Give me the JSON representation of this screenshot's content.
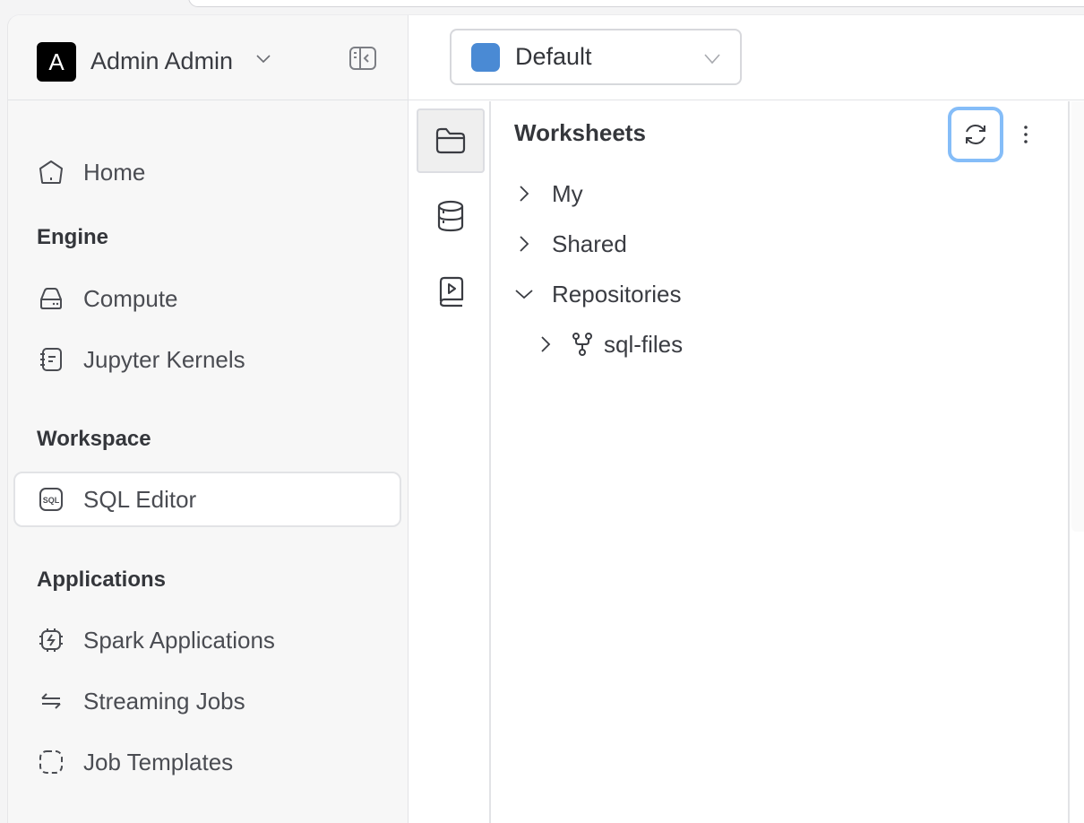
{
  "user": {
    "avatar_letter": "A",
    "name": "Admin Admin"
  },
  "sidebar": {
    "home_label": "Home",
    "sections": [
      {
        "title": "Engine",
        "items": [
          {
            "label": "Compute",
            "icon": "server-icon"
          },
          {
            "label": "Jupyter Kernels",
            "icon": "notebook-icon"
          }
        ]
      },
      {
        "title": "Workspace",
        "items": [
          {
            "label": "SQL Editor",
            "icon": "sql-icon",
            "active": true
          }
        ]
      },
      {
        "title": "Applications",
        "items": [
          {
            "label": "Spark Applications",
            "icon": "spark-chip-icon"
          },
          {
            "label": "Streaming Jobs",
            "icon": "arrows-exchange-icon"
          },
          {
            "label": "Job Templates",
            "icon": "dashed-square-icon"
          }
        ]
      }
    ]
  },
  "header": {
    "environment": {
      "label": "Default",
      "color": "#4a8ad4"
    }
  },
  "rail": {
    "items": [
      {
        "name": "worksheets",
        "icon": "folder-icon",
        "active": true
      },
      {
        "name": "database",
        "icon": "database-icon",
        "active": false
      },
      {
        "name": "tutorials",
        "icon": "book-play-icon",
        "active": false
      }
    ]
  },
  "panel": {
    "title": "Worksheets",
    "tree": [
      {
        "label": "My",
        "expanded": false,
        "depth": 0
      },
      {
        "label": "Shared",
        "expanded": false,
        "depth": 0
      },
      {
        "label": "Repositories",
        "expanded": true,
        "depth": 0
      },
      {
        "label": "sql-files",
        "expanded": false,
        "depth": 1,
        "icon": "git-branch-icon"
      }
    ]
  },
  "colors": {
    "accent_focus": "#85bdf8",
    "env_swatch": "#4a8ad4"
  }
}
